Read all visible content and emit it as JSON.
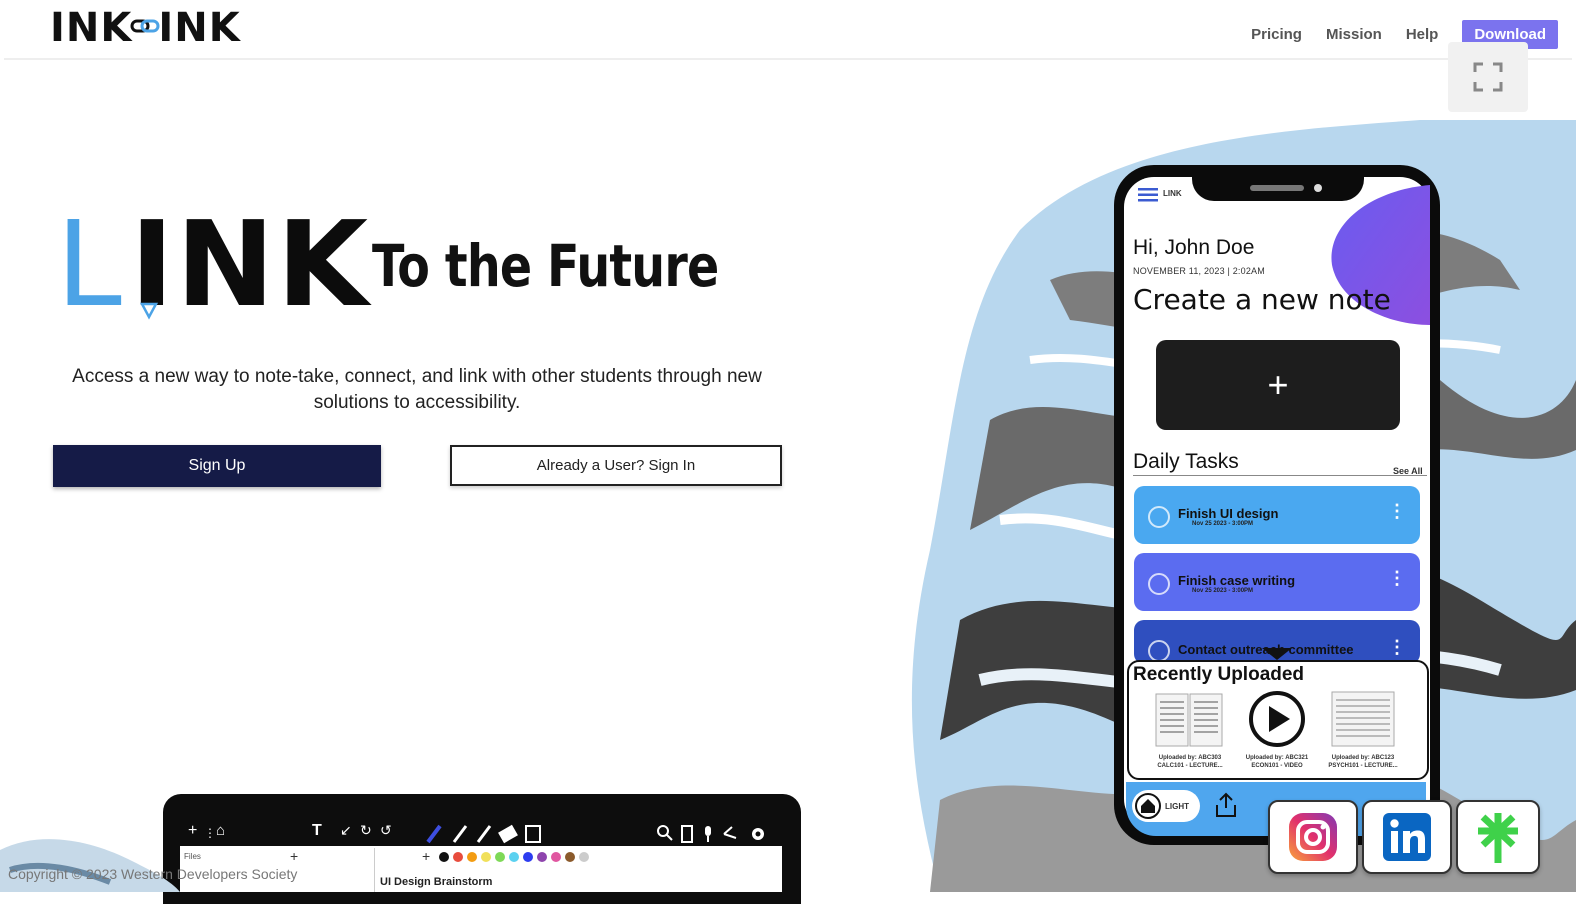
{
  "header": {
    "logo_left": "INK",
    "logo_right": "INK",
    "nav": [
      "Pricing",
      "Mission",
      "Help"
    ],
    "download_label": "Download"
  },
  "hero": {
    "brand_l": "L",
    "brand_ink": "INK",
    "tagline": "To the Future",
    "subtitle": "Access a new way to note-take, connect, and link with other students through new solutions to accessibility.",
    "signup_label": "Sign Up",
    "signin_label": "Already a User? Sign In"
  },
  "phone": {
    "app_logo": "LINK",
    "greeting": "Hi, John Doe",
    "date": "NOVEMBER 11, 2023 | 2:02AM",
    "title": "Create a new note",
    "plus": "+",
    "daily_tasks_label": "Daily Tasks",
    "see_all": "See All",
    "tasks": [
      {
        "title": "Finish UI design",
        "sub": "Nov 25 2023 - 3:00PM",
        "color": "#4aa8f0"
      },
      {
        "title": "Finish case writing",
        "sub": "Nov 25 2023 - 3:00PM",
        "color": "#5b6cf0"
      },
      {
        "title": "Contact outreach committee",
        "sub": "",
        "color": "#2f4fbf"
      }
    ],
    "recently_uploaded_label": "Recently Uploaded",
    "uploads": [
      {
        "caption": "Uploaded by: ABC303 CALC101 - LECTURE..."
      },
      {
        "caption": "Uploaded by: ABC321 ECON101 - VIDEO"
      },
      {
        "caption": "Uploaded by: ABC123 PSYCH101 - LECTURE..."
      }
    ],
    "light_label": "LIGHT"
  },
  "laptop": {
    "files_label": "Files",
    "doc_title": "UI Design Brainstorm",
    "palette": [
      "#111111",
      "#e84c3d",
      "#f39c12",
      "#f1e05a",
      "#7ed957",
      "#5bd1f0",
      "#2d3df0",
      "#8e44ad",
      "#e056a0",
      "#8b5a2b",
      "#cccccc"
    ]
  },
  "footer": {
    "copyright": "Copyright © 2023 Western Developers Society"
  },
  "social": [
    "instagram-icon",
    "linkedin-icon",
    "linktree-icon"
  ],
  "colors": {
    "accent": "#7b73ee",
    "navy": "#151b47",
    "brand_blue": "#4ca3e6"
  }
}
